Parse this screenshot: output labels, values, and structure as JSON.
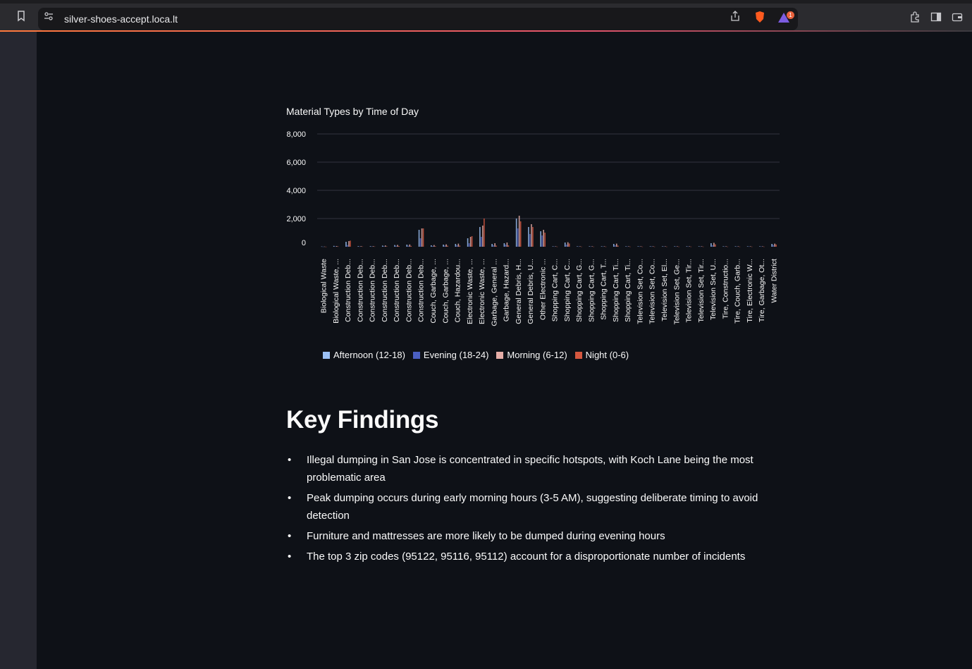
{
  "browser": {
    "url": "silver-shoes-accept.loca.lt",
    "notification_count": "1"
  },
  "chart": {
    "title": "Material Types by Time of Day",
    "y_tick_labels": [
      "8,000",
      "6,000",
      "4,000",
      "2,000",
      "0"
    ],
    "x_tick_labels": [
      "Biological Waste",
      "Biological Waste, ...",
      "Construction Deb...",
      "Construction Deb...",
      "Construction Deb...",
      "Construction Deb...",
      "Construction Deb...",
      "Construction Deb...",
      "Construction Deb...",
      "Couch, Garbage, ...",
      "Couch, Garbage, ...",
      "Couch, Hazardou...",
      "Electronic Waste, ...",
      "Electronic Waste, ...",
      "Garbage, General ...",
      "Garbage, Hazard...",
      "General Debris, H...",
      "General Debris, U...",
      "Other Electronic ...",
      "Shopping Cart, C...",
      "Shopping Cart, C...",
      "Shopping Cart, G...",
      "Shopping Cart, G...",
      "Shopping Cart, T...",
      "Shopping Cart, Ti...",
      "Shopping Cart, Ti...",
      "Television Set, Co...",
      "Television Set, Co...",
      "Television Set, El...",
      "Television Set, Ge...",
      "Television Set, Tir...",
      "Television Set, Tir...",
      "Television Set, U...",
      "Tire, Constructio...",
      "Tire, Couch, Garb...",
      "Tire, Electronic W...",
      "Tire, Garbage, Ot...",
      "Water District"
    ]
  },
  "chart_data": {
    "type": "bar",
    "title": "Material Types by Time of Day",
    "xlabel": "",
    "ylabel": "",
    "ylim": [
      0,
      8000
    ],
    "grid": true,
    "legend_position": "bottom",
    "categories": [
      "Biological Waste",
      "Biological Waste, ...",
      "Construction Deb...",
      "Construction Deb...",
      "Construction Deb...",
      "Construction Deb...",
      "Construction Deb...",
      "Construction Deb...",
      "Construction Deb...",
      "Couch, Garbage, ...",
      "Couch, Garbage, ...",
      "Couch, Hazardou...",
      "Electronic Waste, ...",
      "Electronic Waste, ...",
      "Garbage, General ...",
      "Garbage, Hazard...",
      "General Debris, H...",
      "General Debris, U...",
      "Other Electronic ...",
      "Shopping Cart, C...",
      "Shopping Cart, C...",
      "Shopping Cart, G...",
      "Shopping Cart, G...",
      "Shopping Cart, T...",
      "Shopping Cart, Ti...",
      "Shopping Cart, Ti...",
      "Television Set, Co...",
      "Television Set, Co...",
      "Television Set, El...",
      "Television Set, Ge...",
      "Television Set, Tir...",
      "Television Set, Tir...",
      "Television Set, U...",
      "Tire, Constructio...",
      "Tire, Couch, Garb...",
      "Tire, Electronic W...",
      "Tire, Garbage, Ot...",
      "Water District"
    ],
    "series": [
      {
        "name": "Afternoon (12-18)",
        "color": "#9bc1f5",
        "values": [
          20,
          60,
          350,
          40,
          40,
          80,
          120,
          150,
          1200,
          100,
          150,
          200,
          600,
          1400,
          200,
          250,
          2000,
          1400,
          1100,
          30,
          300,
          30,
          30,
          30,
          200,
          30,
          30,
          30,
          30,
          30,
          30,
          30,
          250,
          30,
          30,
          30,
          30,
          200
        ]
      },
      {
        "name": "Evening (18-24)",
        "color": "#4a5fc1",
        "values": [
          10,
          30,
          120,
          20,
          20,
          40,
          60,
          70,
          600,
          50,
          80,
          100,
          250,
          700,
          100,
          150,
          1300,
          900,
          800,
          20,
          150,
          20,
          20,
          20,
          100,
          20,
          20,
          20,
          20,
          20,
          20,
          20,
          100,
          20,
          20,
          20,
          20,
          120
        ]
      },
      {
        "name": "Morning (6-12)",
        "color": "#e6aea8",
        "values": [
          15,
          50,
          400,
          40,
          40,
          90,
          130,
          160,
          1300,
          120,
          170,
          220,
          700,
          1500,
          250,
          300,
          2200,
          1600,
          1200,
          30,
          320,
          30,
          30,
          30,
          220,
          30,
          30,
          30,
          30,
          30,
          30,
          30,
          280,
          30,
          30,
          30,
          30,
          220
        ]
      },
      {
        "name": "Night (0-6)",
        "color": "#d4573f",
        "values": [
          5,
          20,
          430,
          20,
          20,
          30,
          50,
          60,
          1300,
          40,
          70,
          80,
          750,
          2000,
          80,
          100,
          1800,
          1400,
          1000,
          10,
          230,
          10,
          10,
          10,
          80,
          10,
          10,
          10,
          10,
          10,
          10,
          10,
          170,
          10,
          10,
          10,
          10,
          160
        ]
      }
    ]
  },
  "findings": {
    "heading": "Key Findings",
    "items": [
      "Illegal dumping in San Jose is concentrated in specific hotspots, with Koch Lane being the most problematic area",
      "Peak dumping occurs during early morning hours (3-5 AM), suggesting deliberate timing to avoid detection",
      "Furniture and mattresses are more likely to be dumped during evening hours",
      "The top 3 zip codes (95122, 95116, 95112) account for a disproportionate number of incidents"
    ]
  }
}
